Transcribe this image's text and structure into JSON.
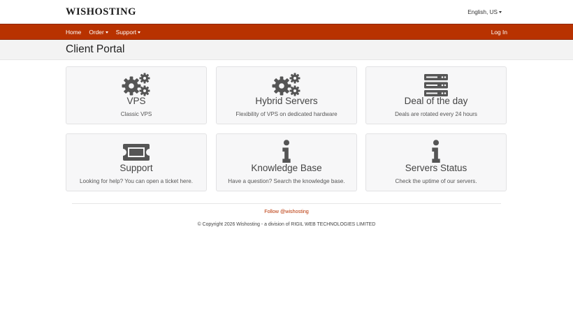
{
  "header": {
    "logo": "WISHOSTING",
    "language": "English, US"
  },
  "nav": {
    "home": "Home",
    "order": "Order",
    "support": "Support",
    "login": "Log In"
  },
  "page": {
    "title": "Client Portal"
  },
  "cards": [
    {
      "icon": "gears-icon",
      "title": "VPS",
      "desc": "Classic VPS"
    },
    {
      "icon": "gears-icon",
      "title": "Hybrid Servers",
      "desc": "Flexibility of VPS on dedicated hardware"
    },
    {
      "icon": "server-icon",
      "title": "Deal of the day",
      "desc": "Deals are rotated every 24 hours"
    },
    {
      "icon": "ticket-icon",
      "title": "Support",
      "desc": "Looking for help? You can open a ticket here."
    },
    {
      "icon": "info-icon",
      "title": "Knowledge Base",
      "desc": "Have a question? Search the knowledge base."
    },
    {
      "icon": "info-icon",
      "title": "Servers Status",
      "desc": "Check the uptime of our servers."
    }
  ],
  "footer": {
    "follow": "Follow @wishosting",
    "copyright": "© Copyright 2026 Wishosting - a division of RIGIL WEB TECHNOLOGIES LIMITED"
  },
  "colors": {
    "brand": "#b83200",
    "icon": "#555555"
  }
}
